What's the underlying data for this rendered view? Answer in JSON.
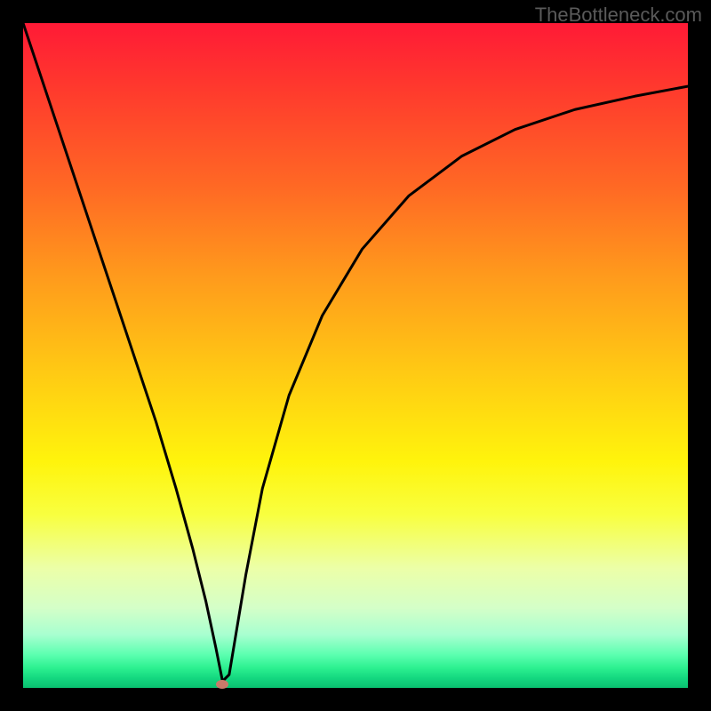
{
  "attribution": "TheBottleneck.com",
  "chart_data": {
    "type": "line",
    "title": "",
    "xlabel": "",
    "ylabel": "",
    "xlim": [
      0,
      1
    ],
    "ylim": [
      0,
      1
    ],
    "legend": false,
    "grid": false,
    "background": "rainbow-gradient-vertical",
    "background_stops": [
      {
        "pos": 0.0,
        "color": "#ff1a36"
      },
      {
        "pos": 0.1,
        "color": "#ff3a2d"
      },
      {
        "pos": 0.25,
        "color": "#ff6a24"
      },
      {
        "pos": 0.38,
        "color": "#ff9a1c"
      },
      {
        "pos": 0.52,
        "color": "#ffc814"
      },
      {
        "pos": 0.66,
        "color": "#fff40c"
      },
      {
        "pos": 0.74,
        "color": "#f8ff40"
      },
      {
        "pos": 0.82,
        "color": "#ecffa8"
      },
      {
        "pos": 0.88,
        "color": "#d4ffc8"
      },
      {
        "pos": 0.92,
        "color": "#a8ffd0"
      },
      {
        "pos": 0.95,
        "color": "#5cffb0"
      },
      {
        "pos": 0.97,
        "color": "#2cf090"
      },
      {
        "pos": 0.985,
        "color": "#14d880"
      },
      {
        "pos": 1.0,
        "color": "#0ac070"
      }
    ],
    "series": [
      {
        "name": "bottleneck-curve",
        "x": [
          0.0,
          0.02,
          0.05,
          0.08,
          0.11,
          0.14,
          0.17,
          0.2,
          0.23,
          0.255,
          0.275,
          0.29,
          0.3,
          0.31,
          0.32,
          0.335,
          0.36,
          0.4,
          0.45,
          0.51,
          0.58,
          0.66,
          0.74,
          0.83,
          0.92,
          1.0
        ],
        "y": [
          1.0,
          0.94,
          0.85,
          0.76,
          0.67,
          0.58,
          0.49,
          0.4,
          0.3,
          0.21,
          0.13,
          0.06,
          0.01,
          0.02,
          0.08,
          0.17,
          0.3,
          0.44,
          0.56,
          0.66,
          0.74,
          0.8,
          0.84,
          0.87,
          0.89,
          0.905
        ],
        "color": "#000000",
        "width": 3
      }
    ],
    "marker": {
      "name": "optimal-point",
      "x": 0.3,
      "y": 0.005,
      "color": "#c97a6a",
      "shape": "ellipse"
    }
  }
}
